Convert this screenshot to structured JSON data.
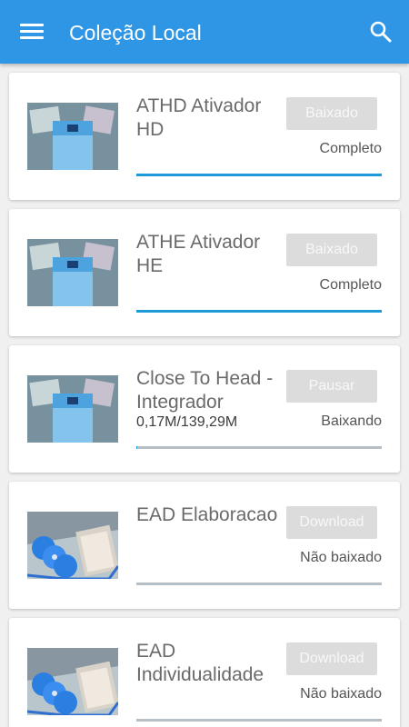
{
  "app_bar": {
    "title": "Coleção Local",
    "menu_icon": "menu-icon",
    "search_icon": "search-icon",
    "color": "#2f96e6"
  },
  "items": [
    {
      "name": "ATHD Ativador HD",
      "sub": "",
      "button": "Baixado",
      "status": "Completo",
      "progress": 1.0,
      "thumb": "cards"
    },
    {
      "name": "ATHE Ativador HE",
      "sub": "",
      "button": "Baixado",
      "status": "Completo",
      "progress": 1.0,
      "thumb": "cards"
    },
    {
      "name": "Close To Head - Integrador",
      "sub": "0,17M/139,29M",
      "button": "Pausar",
      "status": "Baixando",
      "progress": 0.001,
      "thumb": "cards"
    },
    {
      "name": "EAD Elaboracao",
      "sub": "",
      "button": "Download",
      "status": "Não baixado",
      "progress": 0,
      "thumb": "discs"
    },
    {
      "name": "EAD Individualidade",
      "sub": "",
      "button": "Download",
      "status": "Não baixado",
      "progress": 0,
      "thumb": "discs"
    }
  ],
  "colors": {
    "progress_fill": "#1d9ad8",
    "progress_track": "#b6bfc6",
    "button_bg": "#dcdcdc"
  }
}
